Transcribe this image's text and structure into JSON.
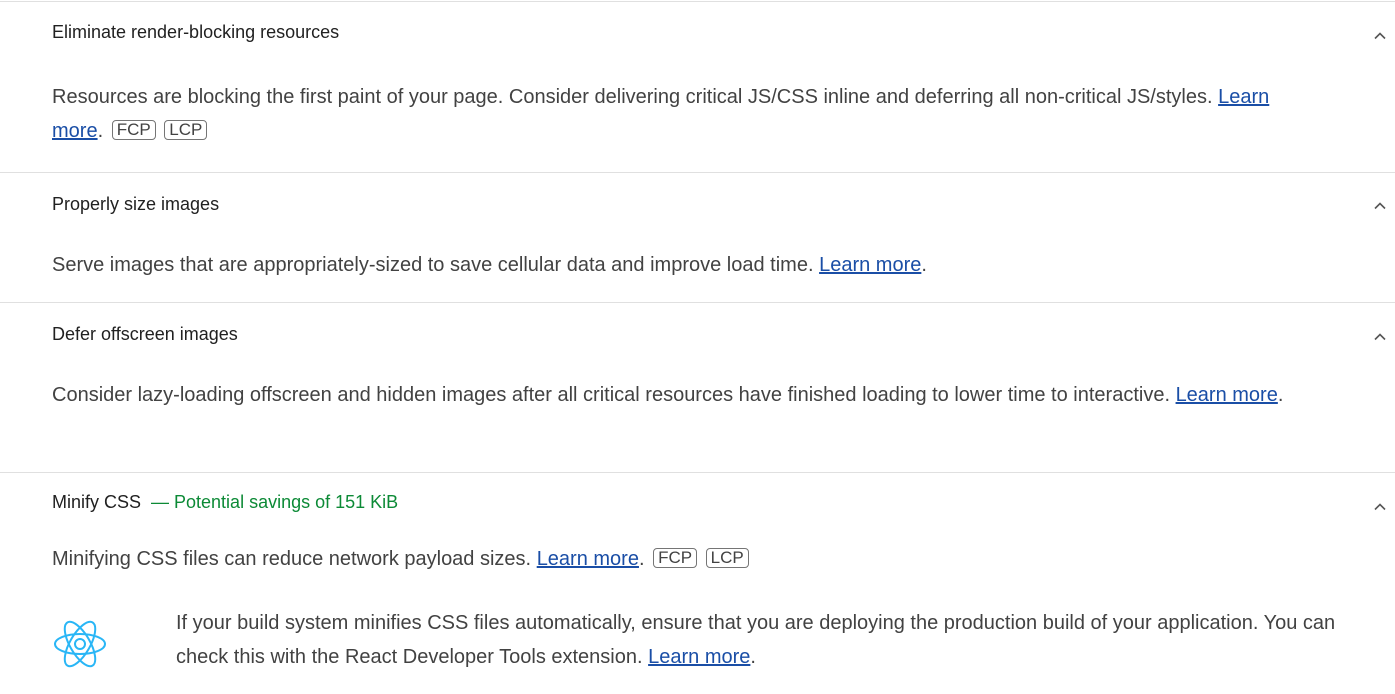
{
  "audits": [
    {
      "title": "Eliminate render-blocking resources",
      "savings": "",
      "description": "Resources are blocking the first paint of your page. Consider delivering critical JS/CSS inline and deferring all non-critical JS/styles.",
      "learn_more": "Learn more",
      "tags": [
        "FCP",
        "LCP"
      ]
    },
    {
      "title": "Properly size images",
      "savings": "",
      "description": "Serve images that are appropriately-sized to save cellular data and improve load time.",
      "learn_more": "Learn more",
      "tags": []
    },
    {
      "title": "Defer offscreen images",
      "savings": "",
      "description": "Consider lazy-loading offscreen and hidden images after all critical resources have finished loading to lower time to interactive.",
      "learn_more": "Learn more",
      "tags": []
    },
    {
      "title": "Minify CSS",
      "savings": "— Potential savings of 151 KiB",
      "description": "Minifying CSS files can reduce network payload sizes.",
      "learn_more": "Learn more",
      "tags": [
        "FCP",
        "LCP"
      ],
      "stack_pack": {
        "icon": "react-icon",
        "description": "If your build system minifies CSS files automatically, ensure that you are deploying the production build of your application. You can check this with the React Developer Tools extension.",
        "learn_more": "Learn more"
      }
    }
  ],
  "colors": {
    "savings": "#0c8a36",
    "link": "#1a4ea6",
    "react": "#29b6f6",
    "divider": "#e0e0e0"
  }
}
